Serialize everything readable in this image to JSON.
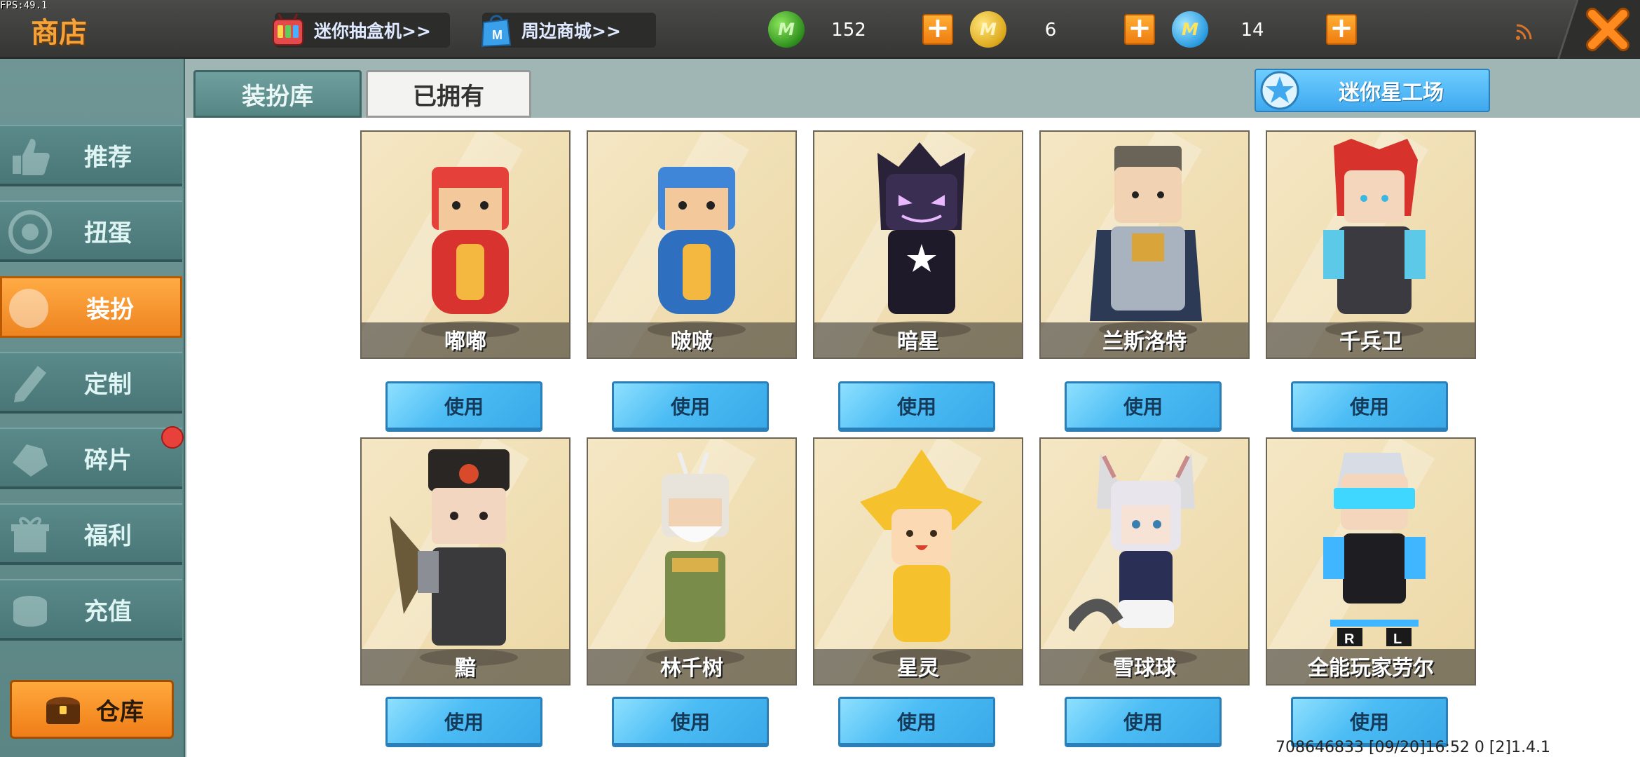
{
  "fps": "FPS:49.1",
  "header": {
    "title": "商店",
    "promos": [
      {
        "label": "迷你抽盒机>>"
      },
      {
        "label": "周边商城>>"
      }
    ],
    "currencies": [
      {
        "name": "gem",
        "symbol": "M",
        "value": "152"
      },
      {
        "name": "gold",
        "symbol": "M",
        "value": "6"
      },
      {
        "name": "blue",
        "symbol": "M",
        "value": "14"
      }
    ],
    "plus_label": "+"
  },
  "sidebar": {
    "items": [
      {
        "label": "推荐"
      },
      {
        "label": "扭蛋"
      },
      {
        "label": "装扮",
        "active": true
      },
      {
        "label": "定制"
      },
      {
        "label": "碎片"
      },
      {
        "label": "福利"
      },
      {
        "label": "充值"
      }
    ],
    "warehouse": "仓库"
  },
  "tabs": [
    {
      "label": "装扮库",
      "active": true
    },
    {
      "label": "已拥有"
    }
  ],
  "workshop_label": "迷你星工场",
  "use_label": "使用",
  "skins": [
    {
      "name": "嘟嘟"
    },
    {
      "name": "啵啵"
    },
    {
      "name": "暗星"
    },
    {
      "name": "兰斯洛特"
    },
    {
      "name": "千兵卫"
    },
    {
      "name": "黯"
    },
    {
      "name": "林千树"
    },
    {
      "name": "星灵"
    },
    {
      "name": "雪球球"
    },
    {
      "name": "全能玩家劳尔"
    }
  ],
  "footer": "708646833    [09/20]16:52 0  [2]1.4.1",
  "colors": {
    "accent_orange": "#f4a23a",
    "button_blue": "#4bbcf4",
    "teal": "#5b8a8b"
  }
}
